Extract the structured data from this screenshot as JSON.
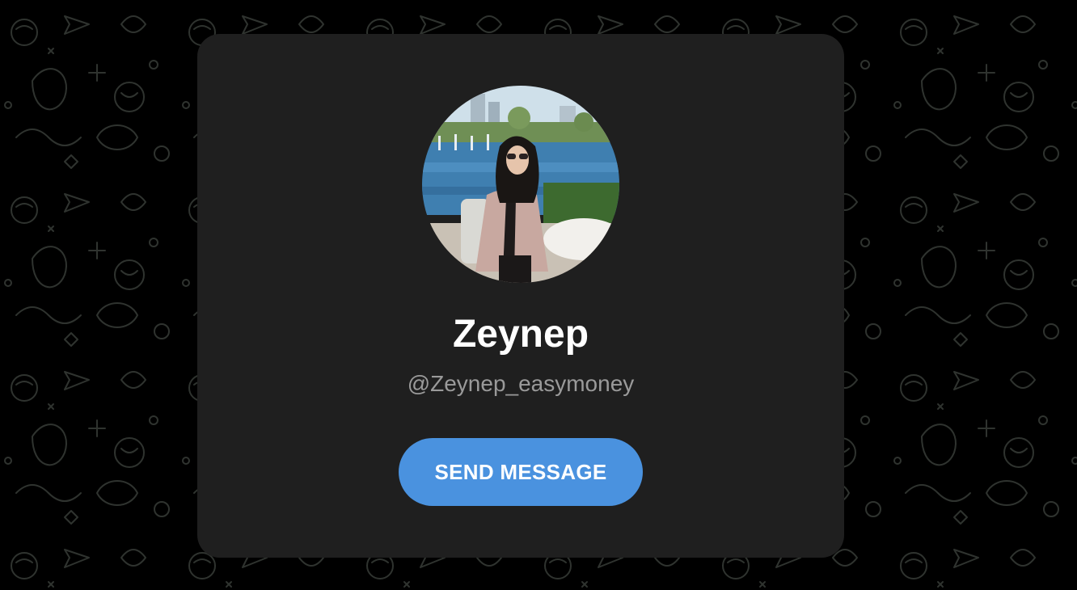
{
  "profile": {
    "name": "Zeynep",
    "username": "@Zeynep_easymoney"
  },
  "actions": {
    "send_message_label": "SEND MESSAGE"
  },
  "colors": {
    "background": "#000000",
    "card": "#1f1f1f",
    "accent": "#4a92df",
    "name_text": "#ffffff",
    "username_text": "#9a9a9a"
  },
  "icons": {
    "background_pattern": "doodle-pattern",
    "avatar": "profile-photo"
  }
}
